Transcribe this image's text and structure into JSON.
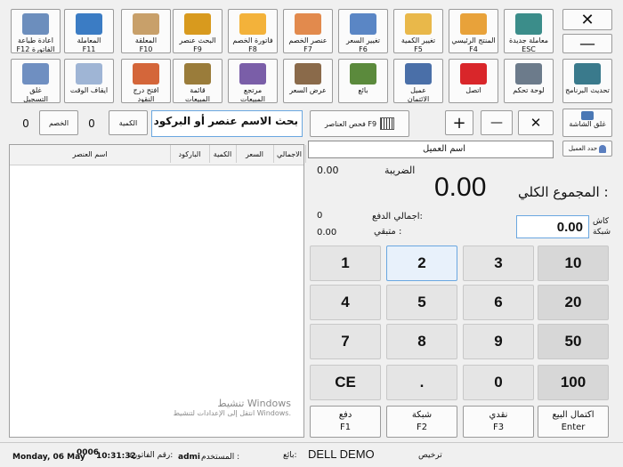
{
  "window_buttons": {
    "close": "✕",
    "minimize": "—"
  },
  "toolbar_row1": [
    {
      "label": "معاملة جديدة\nESC",
      "icon": "register-icon",
      "color": "#3b8d8a"
    },
    {
      "label": "المنتج الرئيسي\nF4",
      "icon": "box-icon",
      "color": "#e8a23a"
    },
    {
      "label": "تغيير الكمية\nF5",
      "icon": "quantity-icon",
      "color": "#e9b84a"
    },
    {
      "label": "تغيير السعر\nF6",
      "icon": "price-icon",
      "color": "#5a86c5"
    },
    {
      "label": "عنصر الخصم\nF7",
      "icon": "discount-bags-icon",
      "color": "#e28a4d"
    },
    {
      "label": "فاتورة الخصم\nF8",
      "icon": "discount-badge-icon",
      "color": "#f3b23a"
    },
    {
      "label": "البحث عنصر\nF9",
      "icon": "barcode-search-icon",
      "color": "#d89a1e"
    },
    {
      "label": "المعلقة\nF10",
      "icon": "suspended-icon",
      "color": "#c8a06a"
    },
    {
      "label": "المعاملة\nF11",
      "icon": "transaction-icon",
      "color": "#3b7cc4"
    },
    {
      "label": "اعادة طباعة\nF12 الفاتورة",
      "icon": "printer-icon",
      "color": "#6c8ebd"
    }
  ],
  "toolbar_row2": [
    {
      "label": "تحديث البرنامج",
      "icon": "refresh-icon",
      "color": "#3a7a8c"
    },
    {
      "label": "لوحة تحكم",
      "icon": "settings-icon",
      "color": "#6c7b8b"
    },
    {
      "label": "اتصل",
      "icon": "connect-icon",
      "color": "#d9262a"
    },
    {
      "label": "عميل\nالائتمان",
      "icon": "credit-customer-icon",
      "color": "#4a6fa8"
    },
    {
      "label": "بائع",
      "icon": "seller-icon",
      "color": "#5b8a3c"
    },
    {
      "label": "عرض السعر",
      "icon": "quote-icon",
      "color": "#8a6a4a"
    },
    {
      "label": "مرتجع\nالمبيعات",
      "icon": "sales-return-icon",
      "color": "#7a5ea8"
    },
    {
      "label": "قائمة\nالمبيعات",
      "icon": "sales-list-icon",
      "color": "#9a7c3a"
    },
    {
      "label": "افتح درج\nالنقود",
      "icon": "cash-drawer-icon",
      "color": "#d4663a"
    },
    {
      "label": "ايقاف الوقت",
      "icon": "clock-icon",
      "color": "#9fb5d5"
    },
    {
      "label": "غلق\nالتسجيل",
      "icon": "close-register-icon",
      "color": "#6f8fc1"
    }
  ],
  "screen_lock": {
    "label": "غلق الشاشة"
  },
  "item_check": {
    "label": "فحص العناصر F9"
  },
  "search": {
    "placeholder": "بحث الاسم عنصر أو البركود",
    "qty_label": "الكمية",
    "qty_value": "0",
    "discount_label": "الخصم",
    "discount_value": "0"
  },
  "table": {
    "columns": [
      "الاجمالي",
      "السعر",
      "الكمية",
      "الباركود",
      "اسم العنصر"
    ]
  },
  "customer": {
    "select_label": "حدد العميل",
    "name_label": "اسم العميل"
  },
  "totals": {
    "tax_label": "الضريبة",
    "tax_value": "0.00",
    "grand_total_label": "المجموع الكلي :",
    "grand_total_value": "0.00",
    "paid_label": "اجمالي الدفع:",
    "paid_value": "0",
    "remaining_label": "متبقي :",
    "remaining_value": "0.00",
    "cash_label": "كاش",
    "card_label": "شبكة",
    "cash_value": "0.00"
  },
  "keypad": {
    "row1": [
      "10",
      "3",
      "2",
      "1"
    ],
    "row2": [
      "20",
      "6",
      "5",
      "4"
    ],
    "row3": [
      "50",
      "9",
      "8",
      "7"
    ],
    "row4": [
      "100",
      "0",
      ".",
      "CE"
    ]
  },
  "payments": [
    {
      "label": "اكتمال البيع",
      "key": "Enter"
    },
    {
      "label": "نقدي",
      "key": "F3"
    },
    {
      "label": "شبكة",
      "key": "F2"
    },
    {
      "label": "دفع",
      "key": "F1"
    }
  ],
  "status_bar": {
    "license_label": "ترخيص",
    "demo_text": "DELL DEMO",
    "seller_label": "بائع:",
    "user_label": "المستخدم :",
    "user_value": "admi",
    "invoice_label": "رقم الفاتورة:",
    "invoice_value": "0006",
    "time": "10:31:32",
    "date": "Monday, 06 May"
  },
  "watermark": {
    "title": "تنشيط Windows",
    "subtitle": "انتقل إلى الإعدادات لتنشيط Windows."
  },
  "colors": {
    "accent_blue": "#6aa7e0",
    "connect_red": "#d9262a"
  }
}
